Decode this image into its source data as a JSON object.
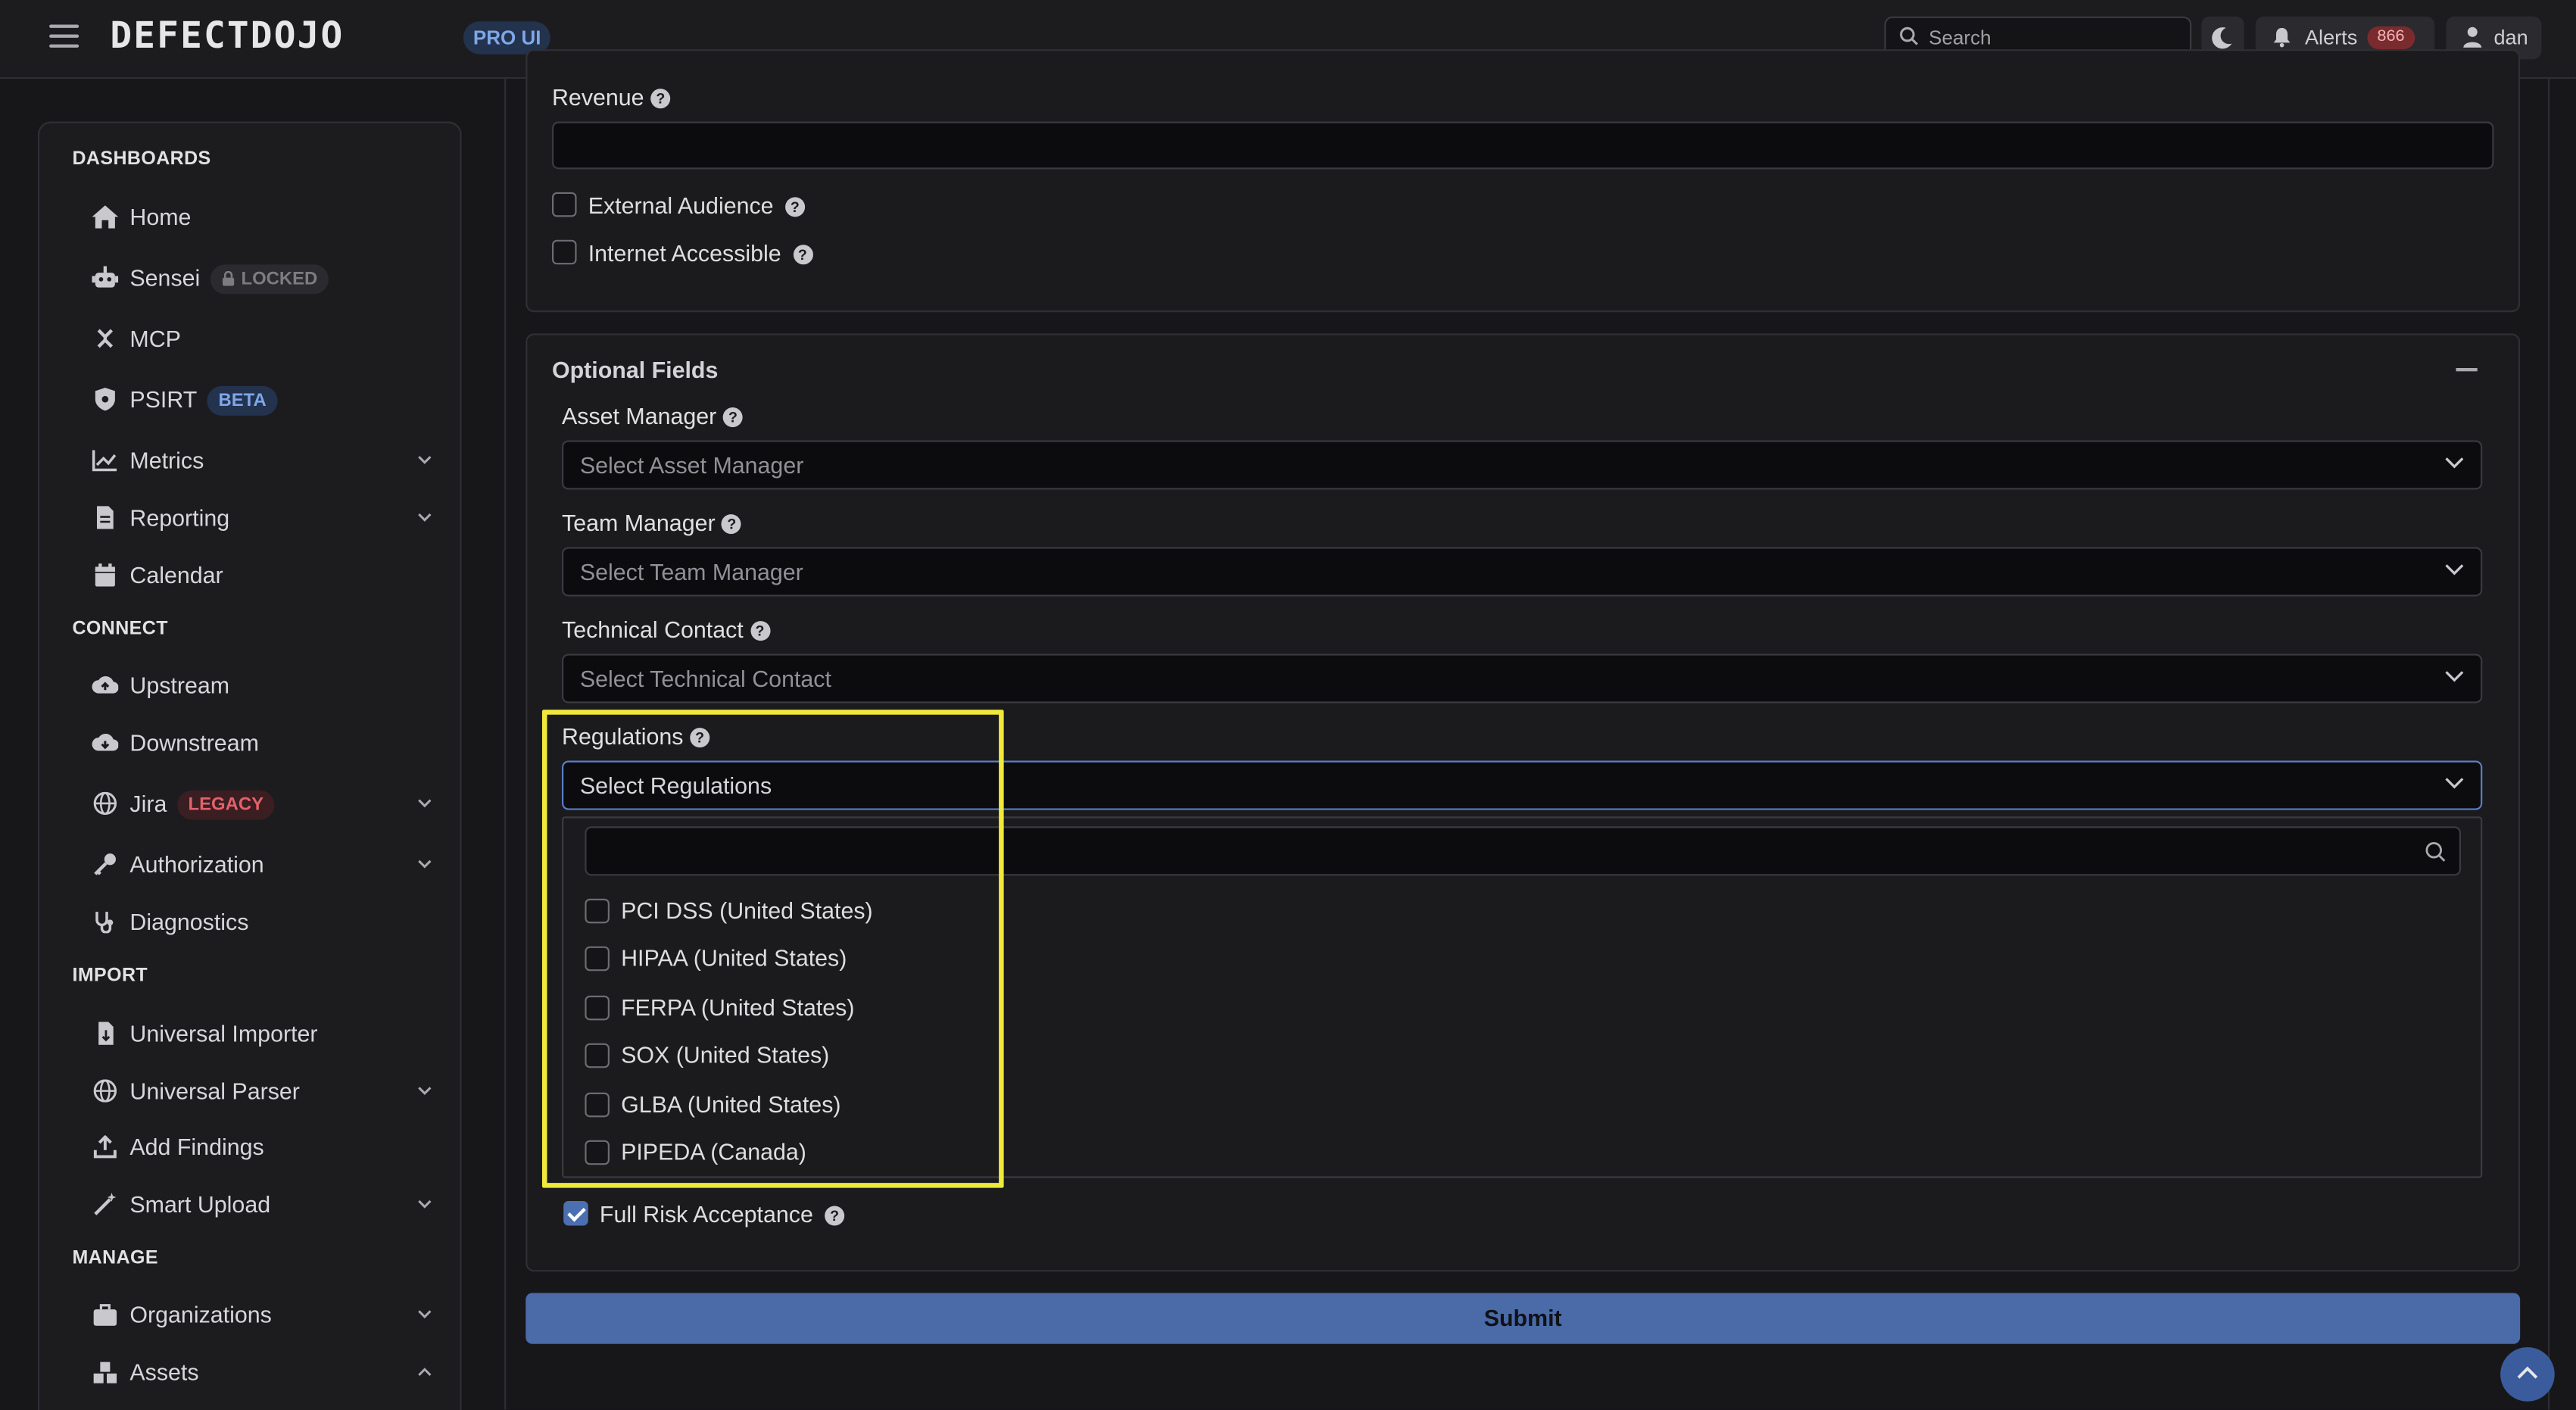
{
  "topbar": {
    "logo_text": "DEFECTDOJO",
    "pro_badge": "PRO UI",
    "search_placeholder": "Search",
    "alerts_label": "Alerts",
    "alerts_count": "866",
    "user_name": "dan"
  },
  "sidebar": {
    "sections": {
      "dashboards": "DASHBOARDS",
      "connect": "CONNECT",
      "import": "IMPORT",
      "manage": "MANAGE"
    },
    "items": {
      "home": "Home",
      "sensei": "Sensei",
      "sensei_tag": "LOCKED",
      "mcp": "MCP",
      "psirt": "PSIRT",
      "psirt_tag": "BETA",
      "metrics": "Metrics",
      "reporting": "Reporting",
      "calendar": "Calendar",
      "upstream": "Upstream",
      "downstream": "Downstream",
      "jira": "Jira",
      "jira_tag": "LEGACY",
      "authorization": "Authorization",
      "diagnostics": "Diagnostics",
      "universal_importer": "Universal Importer",
      "universal_parser": "Universal Parser",
      "add_findings": "Add Findings",
      "smart_upload": "Smart Upload",
      "organizations": "Organizations",
      "assets": "Assets"
    }
  },
  "form": {
    "revenue_label": "Revenue",
    "revenue_value": "",
    "external_audience_label": "External Audience",
    "external_audience_checked": false,
    "internet_accessible_label": "Internet Accessible",
    "internet_accessible_checked": false,
    "optional_fields_title": "Optional Fields",
    "asset_manager_label": "Asset Manager",
    "asset_manager_placeholder": "Select Asset Manager",
    "team_manager_label": "Team Manager",
    "team_manager_placeholder": "Select Team Manager",
    "technical_contact_label": "Technical Contact",
    "technical_contact_placeholder": "Select Technical Contact",
    "regulations_label": "Regulations",
    "regulations_placeholder": "Select Regulations",
    "regulations_search_value": "",
    "regulation_options": [
      "PCI DSS (United States)",
      "HIPAA (United States)",
      "FERPA (United States)",
      "SOX (United States)",
      "GLBA (United States)",
      "PIPEDA (Canada)"
    ],
    "full_risk_acceptance_label": "Full Risk Acceptance",
    "full_risk_acceptance_checked": true,
    "submit_label": "Submit"
  },
  "icons": {
    "help": "?"
  },
  "colors": {
    "accent": "#4b6aa8",
    "highlight": "#f0e83a",
    "legacy": "#e2626a",
    "beta": "#7ea7e8"
  }
}
